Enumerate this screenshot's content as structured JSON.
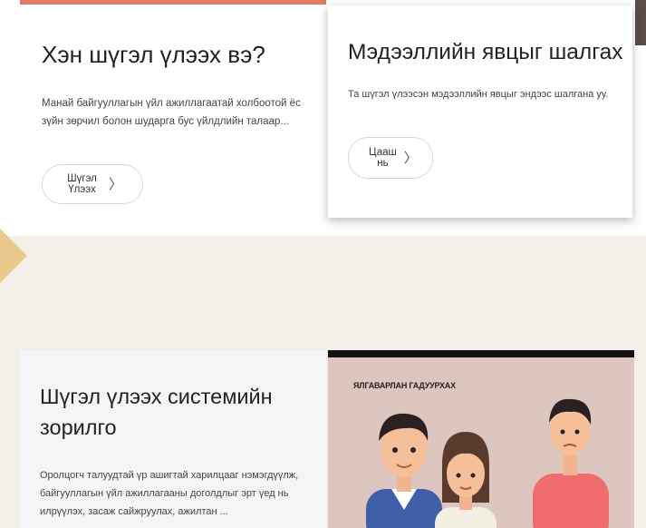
{
  "card_who": {
    "title": "Хэн шүгэл үлээх вэ?",
    "text": "Манай байгууллагын үйл ажиллагаатай холбоотой ёс зүйн зөрчил болон шударга бус үйлдлийн талаар...",
    "button_label": "Шүгэл Үлээх",
    "button_icon": "chevron-right-icon"
  },
  "card_check": {
    "title": "Мэдээллийн явцыг шалгах",
    "text": "Та шүгэл үлээсэн мэдээллийн явцыг эндээс шалгана уу.",
    "button_label": "Цааш нь",
    "button_icon": "chevron-right-icon"
  },
  "goal_section": {
    "title": "Шүгэл үлээх системийн зорилго",
    "text": "Оролцогч талуудтай үр ашигтай харилцааг нэмэгдүүлж, байгууллагын үйл ажиллагааны доголдлыг эрт үед нь илрүүлэх, засаж сайжруулах, ажилтан ..."
  },
  "illustration": {
    "caption": "ЯЛГАВАРЛАН ГАДУУРХАХ"
  },
  "colors": {
    "accent_top_border": "#e27a63",
    "gold_arrow": "#e9c98e",
    "page_background": "#f3f0ea",
    "illustration_background": "#ddc6bf"
  }
}
